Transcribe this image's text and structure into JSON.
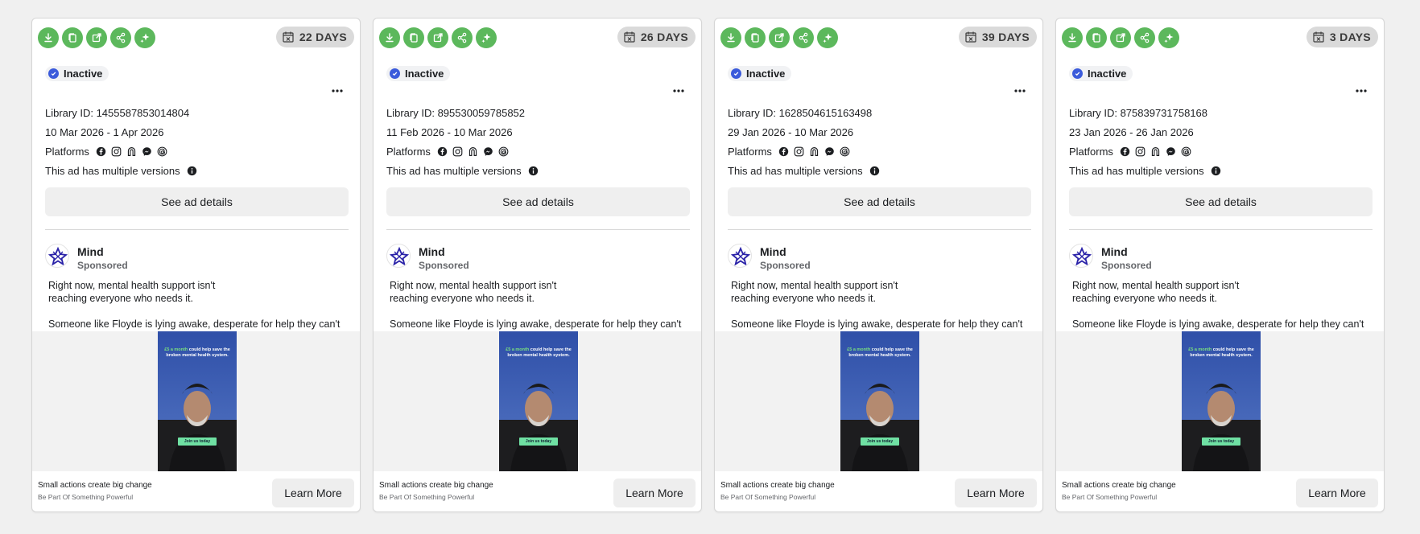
{
  "icons": {
    "toolbar": [
      "download-icon",
      "copy-icon",
      "open-external-icon",
      "share-icon",
      "sparkle-icon"
    ],
    "days": "calendar-x-icon",
    "status": "status-check-icon",
    "more": "more-icon",
    "platforms": [
      "facebook-icon",
      "instagram-icon",
      "audience-network-icon",
      "messenger-icon",
      "threads-icon"
    ],
    "info": "info-icon"
  },
  "colors": {
    "toolbar_green": "#5cb85c",
    "status_blue": "#3b5bdb",
    "days_pill": "#dadada"
  },
  "cards": [
    {
      "days": "22 DAYS",
      "status": "Inactive",
      "library_id": "Library ID: 1455587853014804",
      "date_range": "10 Mar 2026 - 1 Apr 2026",
      "platforms_label": "Platforms",
      "versions_text": "This ad has multiple versions",
      "details_button": "See ad details",
      "advertiser": "Mind",
      "sponsored": "Sponsored",
      "body_line1": "Right now, mental health support isn't",
      "body_line2": "reaching everyone who needs it.",
      "body_line3": " Someone like Floyde is lying awake, desperate for help they can't find.",
      "creative_headline_hl": "£5 a month",
      "creative_headline": " could help save the broken mental health system.",
      "creative_button": "Join us today",
      "cta_title": "Small actions create big change",
      "cta_subtitle": "Be Part Of Something Powerful",
      "cta_button": "Learn More"
    },
    {
      "days": "26 DAYS",
      "status": "Inactive",
      "library_id": "Library ID: 895530059785852",
      "date_range": "11 Feb 2026 - 10 Mar 2026",
      "platforms_label": "Platforms",
      "versions_text": "This ad has multiple versions",
      "details_button": "See ad details",
      "advertiser": "Mind",
      "sponsored": "Sponsored",
      "body_line1": "Right now, mental health support isn't",
      "body_line2": "reaching everyone who needs it.",
      "body_line3": " Someone like Floyde is lying awake, desperate for help they can't find.",
      "creative_headline_hl": "£5 a month",
      "creative_headline": " could help save the broken mental health system.",
      "creative_button": "Join us today",
      "cta_title": "Small actions create big change",
      "cta_subtitle": "Be Part Of Something Powerful",
      "cta_button": "Learn More"
    },
    {
      "days": "39 DAYS",
      "status": "Inactive",
      "library_id": "Library ID: 1628504615163498",
      "date_range": "29 Jan 2026 - 10 Mar 2026",
      "platforms_label": "Platforms",
      "versions_text": "This ad has multiple versions",
      "details_button": "See ad details",
      "advertiser": "Mind",
      "sponsored": "Sponsored",
      "body_line1": "Right now, mental health support isn't",
      "body_line2": "reaching everyone who needs it.",
      "body_line3": " Someone like Floyde is lying awake, desperate for help they can't find.",
      "creative_headline_hl": "£5 a month",
      "creative_headline": " could help save the broken mental health system.",
      "creative_button": "Join us today",
      "cta_title": "Small actions create big change",
      "cta_subtitle": "Be Part Of Something Powerful",
      "cta_button": "Learn More"
    },
    {
      "days": "3 DAYS",
      "status": "Inactive",
      "library_id": "Library ID: 875839731758168",
      "date_range": "23 Jan 2026 - 26 Jan 2026",
      "platforms_label": "Platforms",
      "versions_text": "This ad has multiple versions",
      "details_button": "See ad details",
      "advertiser": "Mind",
      "sponsored": "Sponsored",
      "body_line1": "Right now, mental health support isn't",
      "body_line2": "reaching everyone who needs it.",
      "body_line3": " Someone like Floyde is lying awake, desperate for help they can't find.",
      "creative_headline_hl": "£5 a month",
      "creative_headline": " could help save the broken mental health system.",
      "creative_button": "Join us today",
      "cta_title": "Small actions create big change",
      "cta_subtitle": "Be Part Of Something Powerful",
      "cta_button": "Learn More"
    }
  ]
}
